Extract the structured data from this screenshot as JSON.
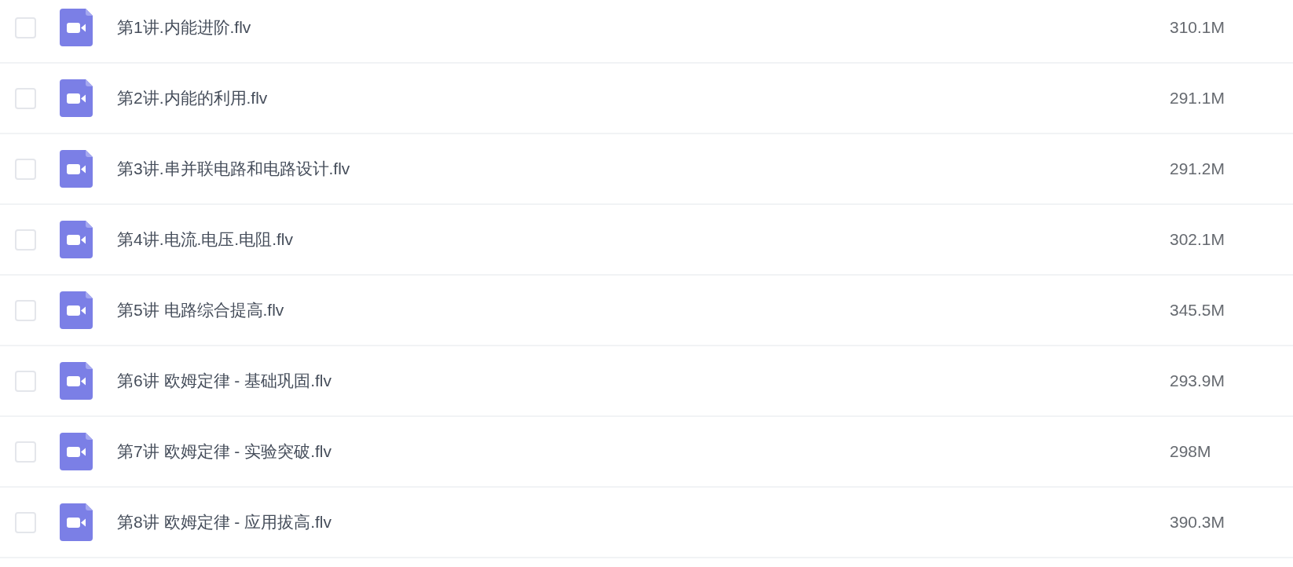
{
  "files": [
    {
      "name": "第1讲.内能进阶.flv",
      "size": "310.1M",
      "checked": false
    },
    {
      "name": "第2讲.内能的利用.flv",
      "size": "291.1M",
      "checked": false
    },
    {
      "name": "第3讲.串并联电路和电路设计.flv",
      "size": "291.2M",
      "checked": false
    },
    {
      "name": "第4讲.电流.电压.电阻.flv",
      "size": "302.1M",
      "checked": false
    },
    {
      "name": "第5讲 电路综合提高.flv",
      "size": "345.5M",
      "checked": false
    },
    {
      "name": "第6讲 欧姆定律 - 基础巩固.flv",
      "size": "293.9M",
      "checked": false
    },
    {
      "name": "第7讲 欧姆定律 - 实验突破.flv",
      "size": "298M",
      "checked": false
    },
    {
      "name": "第8讲 欧姆定律 - 应用拔高.flv",
      "size": "390.3M",
      "checked": false
    }
  ]
}
